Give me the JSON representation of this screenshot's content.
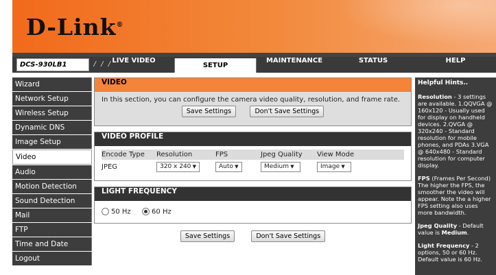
{
  "brand": {
    "logo": "D-Link",
    "trademark": "®"
  },
  "header": {
    "model": "DCS-930LB1",
    "tabs": [
      {
        "label": "LIVE VIDEO",
        "active": false
      },
      {
        "label": "SETUP",
        "active": true
      },
      {
        "label": "MAINTENANCE",
        "active": false
      },
      {
        "label": "STATUS",
        "active": false
      },
      {
        "label": "HELP",
        "active": false
      }
    ]
  },
  "sidebar": {
    "items": [
      {
        "label": "Wizard"
      },
      {
        "label": "Network Setup"
      },
      {
        "label": "Wireless Setup"
      },
      {
        "label": "Dynamic DNS"
      },
      {
        "label": "Image Setup"
      },
      {
        "label": "Video",
        "active": true
      },
      {
        "label": "Audio"
      },
      {
        "label": "Motion Detection"
      },
      {
        "label": "Sound Detection"
      },
      {
        "label": "Mail"
      },
      {
        "label": "FTP"
      },
      {
        "label": "Time and Date"
      },
      {
        "label": "Logout"
      }
    ]
  },
  "video": {
    "title": "VIDEO",
    "description": "In this section, you can configure the camera video quality, resolution, and frame rate.",
    "save_label": "Save Settings",
    "dont_save_label": "Don't Save Settings"
  },
  "profile": {
    "title": "VIDEO PROFILE",
    "columns": [
      "Encode Type",
      "Resolution",
      "FPS",
      "Jpeg Quality",
      "View Mode"
    ],
    "encode_type": "JPEG",
    "resolution": "320 x 240",
    "fps": "Auto",
    "jpeg_quality": "Medium",
    "view_mode": "Image"
  },
  "light": {
    "title": "LIGHT FREQUENCY",
    "opt_50": "50 Hz",
    "opt_60": "60 Hz",
    "selected": "60 Hz"
  },
  "footer": {
    "save_label": "Save Settings",
    "dont_save_label": "Don't Save Settings"
  },
  "help": {
    "title": "Helpful Hints..",
    "res_title": "Resolution",
    "res_text": " - 3 settings are available. 1.QQVGA @ 160x120 - Usually used for display on handheld devices. 2.QVGA @ 320x240 - Standard resolution for mobile phones, and PDAs 3.VGA @ 640x480 - Standard resolution for computer display.",
    "fps_title": "FPS",
    "fps_text": " (Frames Per Second) The higher the FPS, the smoother the video will appear. Note the a higher FPS setting also uses more bandwidth.",
    "jq_title": "Jpeg Quality",
    "jq_text": " - Default value is ",
    "jq_default": "Medium",
    "jq_end": ".",
    "lf_title": "Light Frequency",
    "lf_text": " - 2 options, 50 or 60 Hz. Default value is 60 Hz."
  }
}
